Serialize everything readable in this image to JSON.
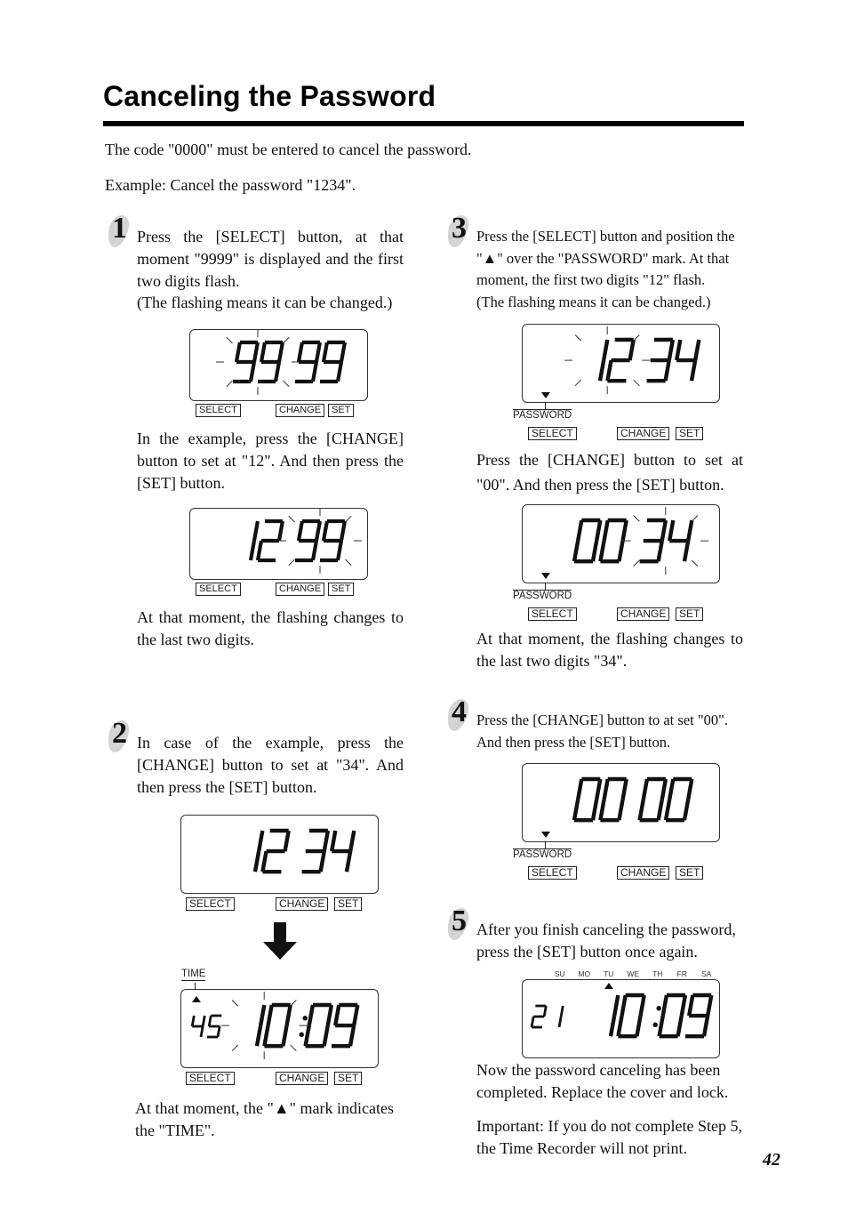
{
  "page": {
    "title": "Canceling the Password",
    "intro_1": "The code \"0000\" must be entered to cancel the password.",
    "intro_2": "Example: Cancel the password \"1234\".",
    "page_number": "42"
  },
  "buttons": {
    "select": "SELECT",
    "change": "CHANGE",
    "set": "SET"
  },
  "marks": {
    "password": "PASSWORD",
    "time": "TIME"
  },
  "days": [
    "SU",
    "MO",
    "TU",
    "WE",
    "TH",
    "FR",
    "SA"
  ],
  "steps": [
    {
      "number": "1",
      "text": "Press the [SELECT] button, at that moment \"9999\" is displayed and the first two digits flash.",
      "note": "(The flashing means it can be changed.)",
      "display_1": {
        "left": "",
        "digits": "9999",
        "flash": "first"
      },
      "text_2": "In the example, press the [CHANGE] button to set at \"12\". And then press the [SET] button.",
      "display_2": {
        "left": "",
        "digits": "1299",
        "flash": "last"
      },
      "text_3": "At that moment, the flashing changes to the last two digits."
    },
    {
      "number": "2",
      "text": "In case of the example, press the [CHANGE] button to set at \"34\". And then press the [SET] button.",
      "display_1": {
        "left": "",
        "digits": "1234",
        "flash": "none"
      },
      "display_2": {
        "left": "45",
        "digits": "1009",
        "colon": true,
        "flash": "first",
        "indicator": "TIME"
      },
      "text_2": "At that moment, the \"▲\" mark indicates the \"TIME\"."
    },
    {
      "number": "3",
      "text": "Press the [SELECT] button and position the \"▲\" over the \"PASSWORD\" mark. At that moment, the first two digits \"12\" flash.",
      "note": "(The flashing means it can be changed.)",
      "display_1": {
        "digits": "1234",
        "flash": "first",
        "indicator": "PASSWORD"
      },
      "text_2": "Press the [CHANGE] button to set at \"00\". And then press the [SET] button.",
      "display_2": {
        "digits": "0034",
        "flash": "last",
        "indicator": "PASSWORD"
      },
      "text_3": "At that moment, the flashing changes to the last two digits \"34\"."
    },
    {
      "number": "4",
      "text": "Press the [CHANGE] button to at set \"00\". And then press the [SET] button.",
      "display_1": {
        "digits": "0000",
        "flash": "none",
        "indicator": "PASSWORD"
      }
    },
    {
      "number": "5",
      "text": "After you finish canceling the password, press the [SET] button once again.",
      "display_1": {
        "left": "21",
        "digits": "1009",
        "colon": true,
        "flash": "none",
        "day_indicator": "TU"
      },
      "text_2": "Now the password canceling has been completed. Replace the cover and lock.",
      "text_3": "Important: If you do not complete Step 5, the Time Recorder will  not print."
    }
  ]
}
